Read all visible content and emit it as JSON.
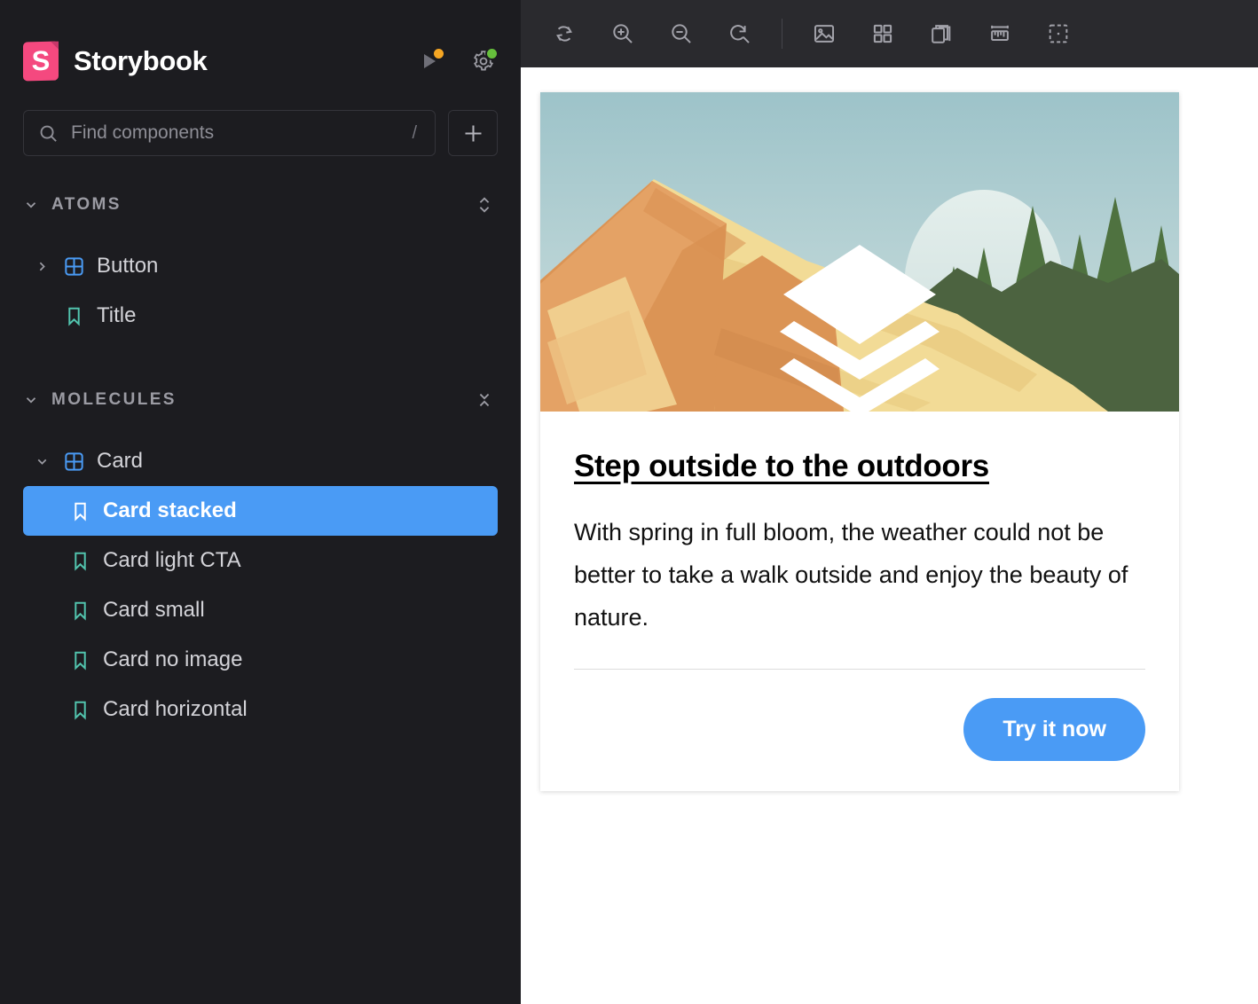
{
  "brand": {
    "name": "Storybook",
    "logo_letter": "S",
    "logo_color": "#f4497f",
    "play_badge_color": "#f5a623",
    "settings_badge_color": "#66bf3c"
  },
  "search": {
    "placeholder": "Find components",
    "shortcut": "/"
  },
  "sidebar": {
    "groups": [
      {
        "label": "ATOMS",
        "items": [
          {
            "label": "Button",
            "icon": "component-icon",
            "expandable": true,
            "expanded": false,
            "depth": 1
          },
          {
            "label": "Title",
            "icon": "story-icon",
            "expandable": false,
            "expanded": false,
            "depth": 1
          }
        ]
      },
      {
        "label": "MOLECULES",
        "items": [
          {
            "label": "Card",
            "icon": "component-icon",
            "expandable": true,
            "expanded": true,
            "depth": 1,
            "selected": false
          },
          {
            "label": "Card stacked",
            "icon": "story-icon",
            "expandable": false,
            "expanded": false,
            "depth": 2,
            "selected": true
          },
          {
            "label": "Card light CTA",
            "icon": "story-icon",
            "expandable": false,
            "expanded": false,
            "depth": 2,
            "selected": false
          },
          {
            "label": "Card small",
            "icon": "story-icon",
            "expandable": false,
            "expanded": false,
            "depth": 2,
            "selected": false
          },
          {
            "label": "Card no image",
            "icon": "story-icon",
            "expandable": false,
            "expanded": false,
            "depth": 2,
            "selected": false
          },
          {
            "label": "Card horizontal",
            "icon": "story-icon",
            "expandable": false,
            "expanded": false,
            "depth": 2,
            "selected": false
          }
        ]
      }
    ],
    "selection_color": "#4a9bf5"
  },
  "toolbar": {
    "items": [
      {
        "name": "remount-icon",
        "title": "Remount component"
      },
      {
        "name": "zoom-in-icon",
        "title": "Zoom in"
      },
      {
        "name": "zoom-out-icon",
        "title": "Zoom out"
      },
      {
        "name": "zoom-reset-icon",
        "title": "Reset zoom"
      },
      {
        "name": "separator",
        "title": ""
      },
      {
        "name": "backgrounds-icon",
        "title": "Change background"
      },
      {
        "name": "grid-icon",
        "title": "Show grid"
      },
      {
        "name": "viewport-icon",
        "title": "Change viewport"
      },
      {
        "name": "measure-icon",
        "title": "Measure"
      },
      {
        "name": "outline-icon",
        "title": "Outline"
      }
    ]
  },
  "card": {
    "title": "Step outside to the outdoors",
    "body": "With spring in full bloom, the weather could not be better to take a walk outside and enjoy the beauty of nature.",
    "cta_label": "Try it now",
    "cta_color": "#4a9bf5",
    "image": {
      "alt": "Mountain landscape with pine trees and stacked layers icon",
      "sky_top": "#9dc3c9",
      "sky_bottom": "#cfe0df",
      "sun_color": "#dde9e7",
      "tree_color": "#4f7240",
      "forest_color": "#4c6340",
      "mountain_light": "#f2db96",
      "mountain_mid": "#e8bf76",
      "mountain_dark": "#db9455",
      "layers_color": "#ffffff"
    }
  }
}
